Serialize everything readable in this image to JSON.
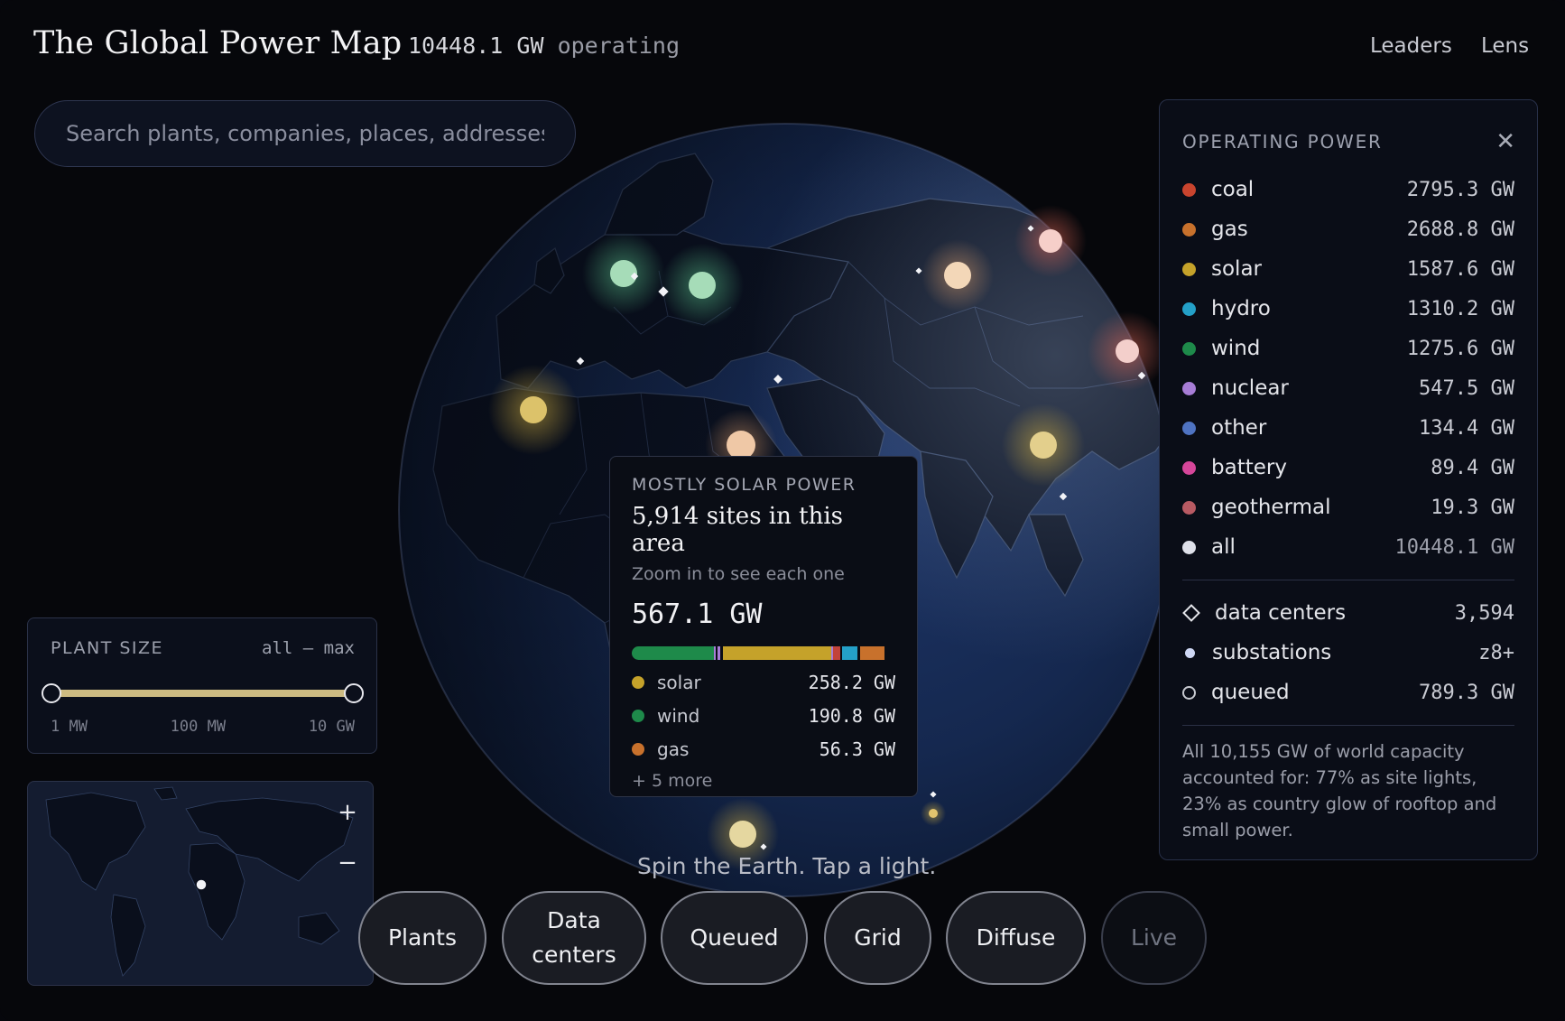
{
  "header": {
    "title": "The Global Power Map",
    "operating_value": "10448.1 GW",
    "operating_label": "operating",
    "nav": {
      "leaders": "Leaders",
      "lens": "Lens"
    }
  },
  "search": {
    "placeholder": "Search plants, companies, places, addresses"
  },
  "tooltip": {
    "kicker": "MOSTLY SOLAR POWER",
    "headline": "5,914 sites in this area",
    "hint": "Zoom in to see each one",
    "total": "567.1 GW",
    "mix_bar": [
      {
        "color": "#1e8a4a",
        "fraction": 0.31
      },
      {
        "color": "#a77dd6",
        "fraction": 0.01
      },
      {
        "color": "#0a0d15",
        "fraction": 0.005
      },
      {
        "color": "#a77dd6",
        "fraction": 0.01
      },
      {
        "color": "#0a0d15",
        "fraction": 0.012
      },
      {
        "color": "#c5a22a",
        "fraction": 0.41
      },
      {
        "color": "#a77dd6",
        "fraction": 0.008
      },
      {
        "color": "#c2433a",
        "fraction": 0.026
      },
      {
        "color": "#0a0d15",
        "fraction": 0.006
      },
      {
        "color": "#24a0c8",
        "fraction": 0.06
      },
      {
        "color": "#0a0d15",
        "fraction": 0.008
      },
      {
        "color": "#c8712c",
        "fraction": 0.095
      }
    ],
    "rows": [
      {
        "label": "solar",
        "value": "258.2 GW",
        "color": "#c5a22a"
      },
      {
        "label": "wind",
        "value": "190.8 GW",
        "color": "#1e8a4a"
      },
      {
        "label": "gas",
        "value": "56.3 GW",
        "color": "#c8712c"
      }
    ],
    "more": "+ 5 more"
  },
  "legend": {
    "title": "OPERATING POWER",
    "close": "✕",
    "sources": [
      {
        "label": "coal",
        "value": "2795.3 GW",
        "color": "#c9442e"
      },
      {
        "label": "gas",
        "value": "2688.8 GW",
        "color": "#c8712c"
      },
      {
        "label": "solar",
        "value": "1587.6 GW",
        "color": "#c5a22a"
      },
      {
        "label": "hydro",
        "value": "1310.2 GW",
        "color": "#24a0c8"
      },
      {
        "label": "wind",
        "value": "1275.6 GW",
        "color": "#1e8a4a"
      },
      {
        "label": "nuclear",
        "value": "547.5 GW",
        "color": "#a77dd6"
      },
      {
        "label": "other",
        "value": "134.4 GW",
        "color": "#4f73c2"
      },
      {
        "label": "battery",
        "value": "89.4 GW",
        "color": "#d6469a"
      },
      {
        "label": "geothermal",
        "value": "19.3 GW",
        "color": "#b85a63"
      },
      {
        "label": "all",
        "value": "10448.1 GW",
        "color": "#dfe1ea"
      }
    ],
    "extras": {
      "data_centers": {
        "label": "data centers",
        "value": "3,594"
      },
      "substations": {
        "label": "substations",
        "value": "z8+"
      },
      "queued": {
        "label": "queued",
        "value": "789.3 GW"
      }
    },
    "note": "All 10,155 GW of world capacity accounted for: 77% as site lights, 23% as country glow of rooftop and small power."
  },
  "plant_size": {
    "title": "PLANT SIZE",
    "range": "all — max",
    "ticks": [
      "1 MW",
      "100 MW",
      "10 GW"
    ],
    "slider_min": 0,
    "slider_max": 1
  },
  "minimap": {
    "zoom_in": "+",
    "zoom_out": "−"
  },
  "hint": "Spin the Earth. Tap a light.",
  "buttons": {
    "plants": "Plants",
    "data_centers_line1": "Data",
    "data_centers_line2": "centers",
    "queued": "Queued",
    "grid": "Grid",
    "diffuse": "Diffuse",
    "live": "Live"
  }
}
